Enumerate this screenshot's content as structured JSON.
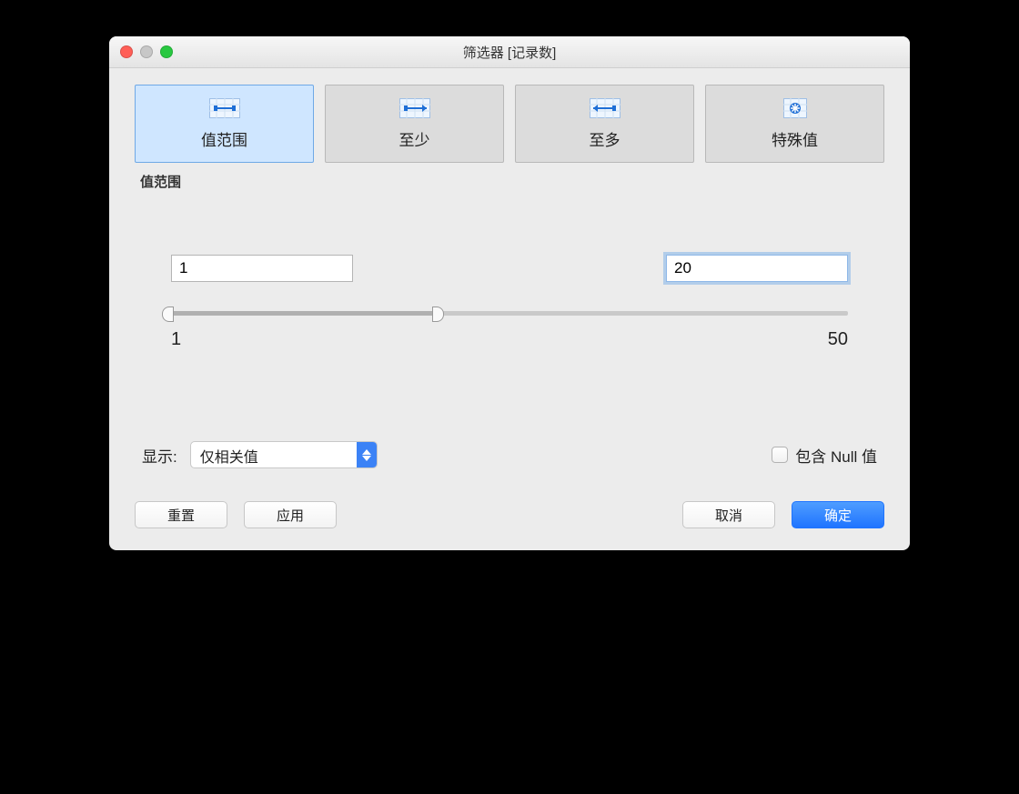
{
  "window": {
    "title": "筛选器 [记录数]"
  },
  "tabs": {
    "range": {
      "label": "值范围"
    },
    "atleast": {
      "label": "至少"
    },
    "atmost": {
      "label": "至多"
    },
    "special": {
      "label": "特殊值"
    }
  },
  "subheading": "值范围",
  "range": {
    "from_value": "1",
    "to_value": "20",
    "min_label": "1",
    "max_label": "50",
    "min": 1,
    "max": 50,
    "from": 1,
    "to": 20
  },
  "display": {
    "label": "显示:",
    "selected": "仅相关值"
  },
  "null_checkbox": {
    "label": "包含 Null 值",
    "checked": false
  },
  "buttons": {
    "reset": "重置",
    "apply": "应用",
    "cancel": "取消",
    "ok": "确定"
  }
}
